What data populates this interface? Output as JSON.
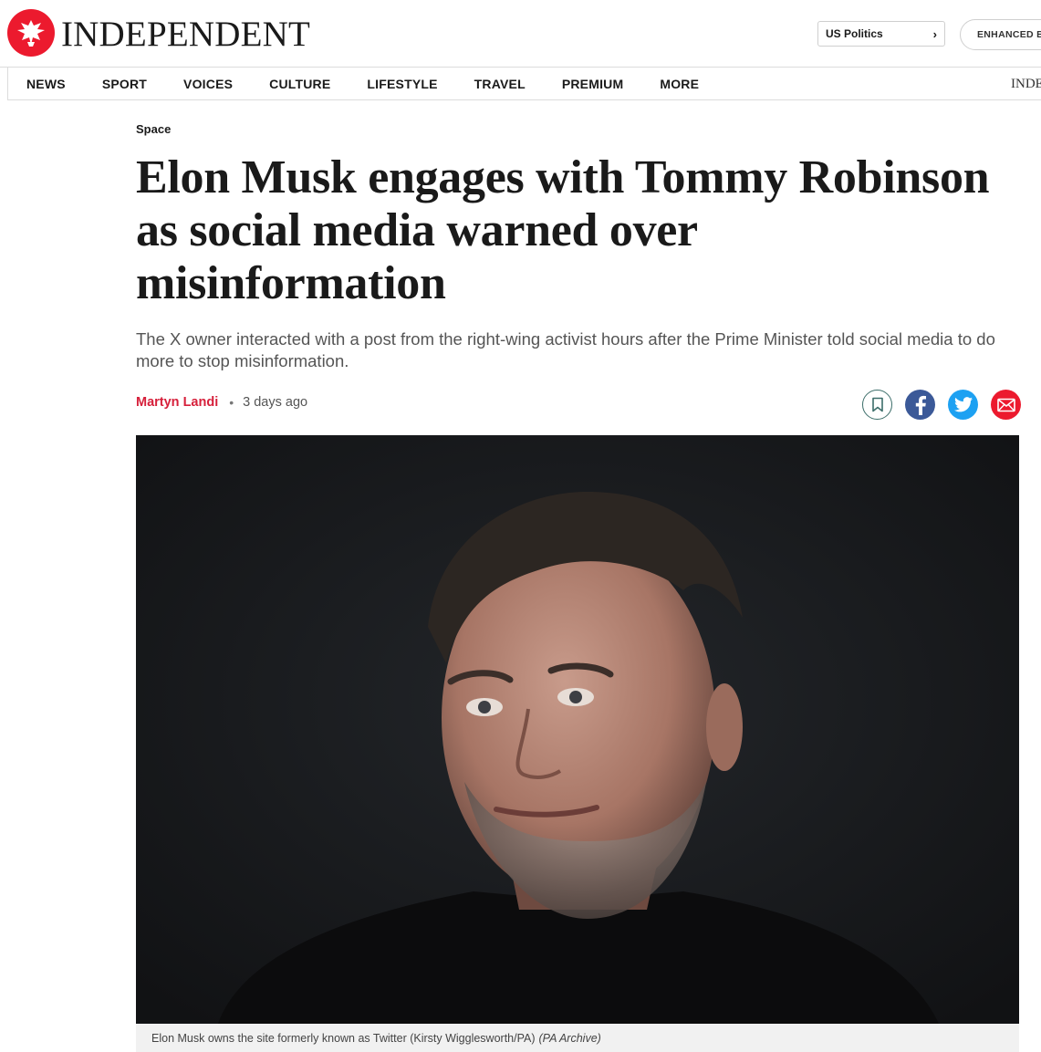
{
  "header": {
    "logo_text": "INDEPENDENT",
    "topic_select": "US Politics",
    "enhanced_label": "ENHANCED BY"
  },
  "nav": {
    "items": [
      "NEWS",
      "SPORT",
      "VOICES",
      "CULTURE",
      "LIFESTYLE",
      "TRAVEL",
      "PREMIUM",
      "MORE"
    ],
    "edge_text": "INDEPENDENT"
  },
  "article": {
    "section": "Space",
    "headline": "Elon Musk engages with Tommy Robinson as social media warned over misinformation",
    "standfirst": "The X owner interacted with a post from the right-wing activist hours after the Prime Minister told social media to do more to stop misinformation.",
    "author": "Martyn Landi",
    "separator": "•",
    "time_ago": "3 days ago",
    "share_icons": [
      "bookmark-icon",
      "facebook-icon",
      "twitter-icon",
      "email-icon"
    ],
    "image": {
      "caption": "Elon Musk owns the site formerly known as Twitter (Kirsty Wigglesworth/PA)",
      "credit": "(PA Archive)"
    }
  },
  "colors": {
    "brand_red": "#ec1a2e",
    "author_red": "#d6203b",
    "facebook": "#3b5998",
    "twitter": "#1da1f2",
    "bookmark_teal": "#3c6e6a"
  }
}
